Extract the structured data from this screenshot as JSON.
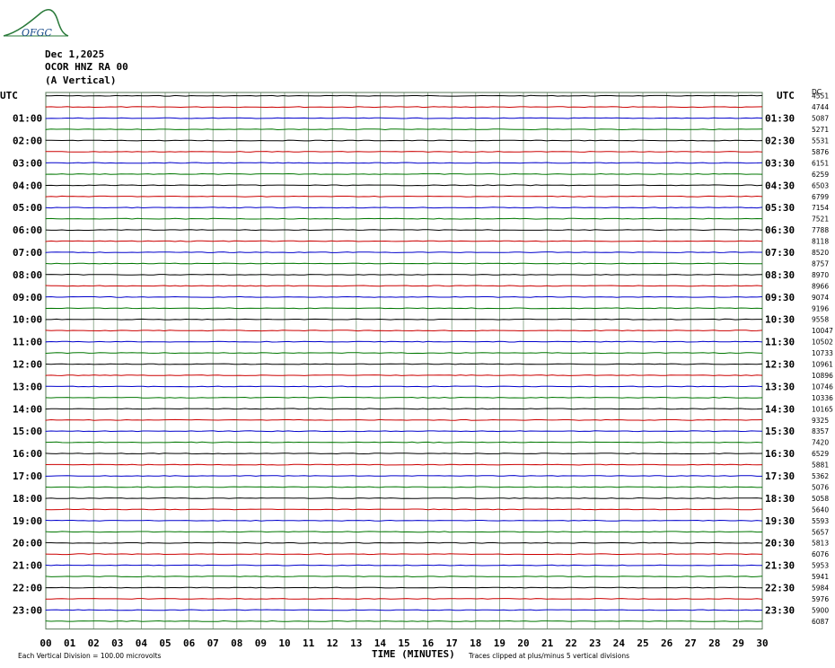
{
  "header": {
    "date": "Dec 1,2025",
    "station": "OCOR HNZ RA 00",
    "component": "(A Vertical)",
    "logo_text": "OFGC"
  },
  "utc_left": "UTC",
  "utc_right": "UTC",
  "top_right_label": "DC",
  "footer": {
    "x_axis_title": "TIME (MINUTES)",
    "scale_note": "Each Vertical Division = 100.00 microvolts",
    "clip_note": "Traces clipped at plus/minus 5 vertical divisions"
  },
  "chart_data": {
    "type": "line",
    "title": "",
    "xlabel": "TIME (MINUTES)",
    "xlim": [
      0,
      30
    ],
    "x_ticks": [
      "00",
      "01",
      "02",
      "03",
      "04",
      "05",
      "06",
      "07",
      "08",
      "09",
      "10",
      "11",
      "12",
      "13",
      "14",
      "15",
      "16",
      "17",
      "18",
      "19",
      "20",
      "21",
      "22",
      "23",
      "24",
      "25",
      "26",
      "27",
      "28",
      "29",
      "30"
    ],
    "trace_colors": [
      "#000000",
      "#cc0000",
      "#0000cc",
      "#007700"
    ],
    "grid_color": "#7a9a7a",
    "left_hour_labels": [
      "01:00",
      "02:00",
      "03:00",
      "04:00",
      "05:00",
      "06:00",
      "07:00",
      "08:00",
      "09:00",
      "10:00",
      "11:00",
      "12:00",
      "13:00",
      "14:00",
      "15:00",
      "16:00",
      "17:00",
      "18:00",
      "19:00",
      "20:00",
      "21:00",
      "22:00",
      "23:00"
    ],
    "right_hour_labels": [
      "01:30",
      "02:30",
      "03:30",
      "04:30",
      "05:30",
      "06:30",
      "07:30",
      "08:30",
      "09:30",
      "10:30",
      "11:30",
      "12:30",
      "13:30",
      "14:30",
      "15:30",
      "16:30",
      "17:30",
      "18:30",
      "19:30",
      "20:30",
      "21:30",
      "22:30",
      "23:30"
    ],
    "trace_counts": [
      "4551",
      "4744",
      "5087",
      "5271",
      "5531",
      "5876",
      "6151",
      "6259",
      "6503",
      "6799",
      "7154",
      "7521",
      "7788",
      "8118",
      "8520",
      "8757",
      "8970",
      "8966",
      "9074",
      "9196",
      "9558",
      "10047",
      "10502",
      "10733",
      "10961",
      "10896",
      "10746",
      "10336",
      "10165",
      "9325",
      "8357",
      "7420",
      "6529",
      "5881",
      "5362",
      "5076",
      "5058",
      "5640",
      "5593",
      "5657",
      "5813",
      "6076",
      "5953",
      "5941",
      "5984",
      "5976",
      "5900",
      "6087"
    ]
  }
}
